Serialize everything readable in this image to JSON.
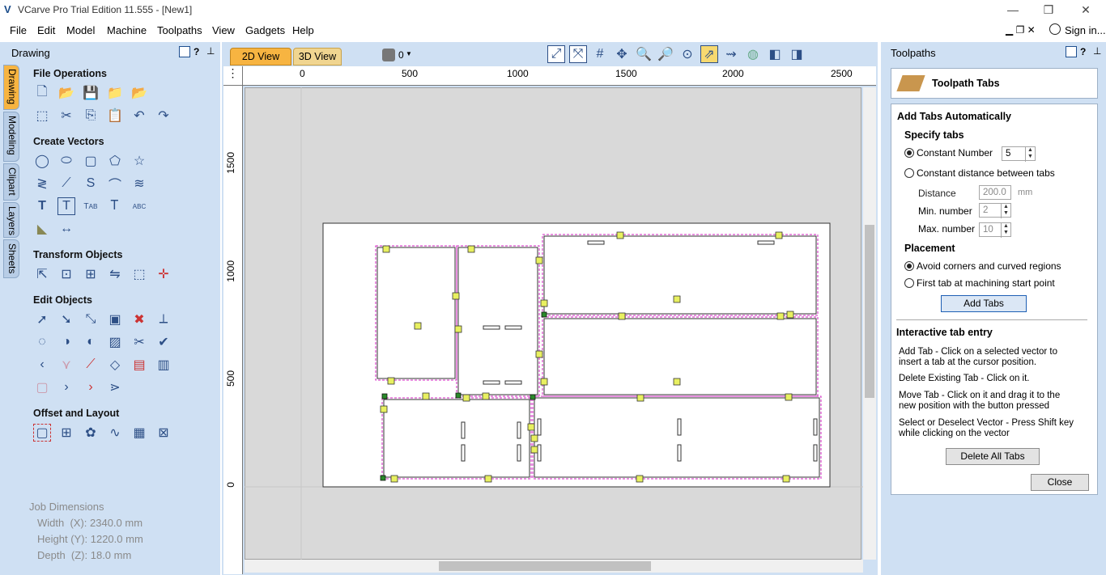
{
  "window": {
    "title": "VCarve Pro Trial Edition 11.555 - [New1]",
    "minimize": "—",
    "restore": "❒",
    "close": "✕"
  },
  "menu": {
    "items": [
      "File",
      "Edit",
      "Model",
      "Machine",
      "Toolpaths",
      "View",
      "Gadgets",
      "Help"
    ],
    "sign_in": "Sign in..."
  },
  "left_panel": {
    "title": "Drawing",
    "help": "?",
    "tabs": [
      "Drawing",
      "Modeling",
      "Clipart",
      "Layers",
      "Sheets"
    ],
    "sections": {
      "file_ops": "File Operations",
      "create_vectors": "Create Vectors",
      "transform": "Transform Objects",
      "edit": "Edit Objects",
      "offset": "Offset and Layout"
    },
    "job": {
      "heading": "Job Dimensions",
      "width": "Width  (X): 2340.0 mm",
      "height": "Height (Y): 1220.0 mm",
      "depth": "Depth  (Z): 18.0 mm"
    }
  },
  "view": {
    "tab_2d": "2D View",
    "tab_3d": "3D View",
    "layer_count": "0",
    "ruler_x": [
      "0",
      "500",
      "1000",
      "1500",
      "2000",
      "2500"
    ],
    "ruler_y": [
      "1500",
      "1000",
      "500",
      "0"
    ]
  },
  "right_panel": {
    "title": "Toolpaths",
    "help": "?",
    "header": "Toolpath Tabs",
    "auto_title": "Add Tabs Automatically",
    "specify": "Specify tabs",
    "opt_constant_number": "Constant Number",
    "constant_value": "5",
    "opt_constant_distance": "Constant distance between tabs",
    "distance_label": "Distance",
    "distance_value": "200.0",
    "distance_unit": "mm",
    "min_label": "Min. number",
    "min_value": "2",
    "max_label": "Max. number",
    "max_value": "10",
    "placement": "Placement",
    "opt_avoid": "Avoid corners and curved regions",
    "opt_first": "First tab at machining start point",
    "add_tabs": "Add Tabs",
    "interactive_title": "Interactive tab entry",
    "help_add": "Add Tab - Click on a selected vector to insert a tab at the cursor position.",
    "help_delete": "Delete Existing Tab - Click on it.",
    "help_move": "Move Tab - Click on it and drag it to the new position with the button pressed",
    "help_select": "Select or Deselect Vector - Press Shift key while clicking on the vector",
    "delete_all": "Delete All Tabs",
    "close": "Close"
  },
  "colors": {
    "accent": "#f7b441",
    "panel": "#cfe0f3",
    "toolpath": "#d020c0",
    "tab_marker": "#e8f060"
  }
}
